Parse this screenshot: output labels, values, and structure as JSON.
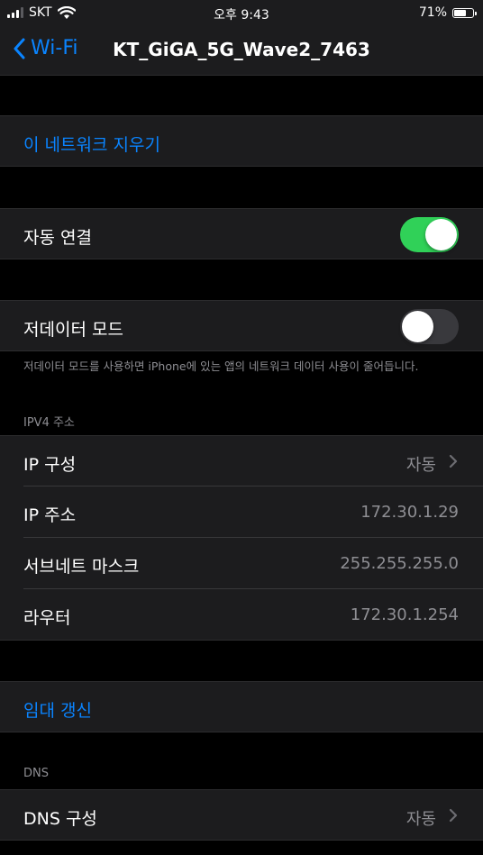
{
  "status_bar": {
    "carrier": "SKT",
    "time": "오후 9:43",
    "battery_percent": "71%",
    "battery_level": 0.71
  },
  "nav": {
    "back_label": "Wi-Fi",
    "title": "KT_GiGA_5G_Wave2_7463"
  },
  "forget_network": {
    "label": "이 네트워크 지우기"
  },
  "auto_join": {
    "label": "자동 연결",
    "enabled": true
  },
  "low_data_mode": {
    "label": "저데이터 모드",
    "enabled": false,
    "footer": "저데이터 모드를 사용하면 iPhone에 있는 앱의 네트워크 데이터 사용이 줄어듭니다."
  },
  "ipv4": {
    "header": "IPV4 주소",
    "rows": [
      {
        "label": "IP 구성",
        "value": "자동",
        "chevron": true
      },
      {
        "label": "IP 주소",
        "value": "172.30.1.29",
        "chevron": false
      },
      {
        "label": "서브네트 마스크",
        "value": "255.255.255.0",
        "chevron": false
      },
      {
        "label": "라우터",
        "value": "172.30.1.254",
        "chevron": false
      }
    ]
  },
  "renew_lease": {
    "label": "임대 갱신"
  },
  "dns": {
    "header": "DNS",
    "configure_label": "DNS 구성",
    "configure_value": "자동"
  },
  "colors": {
    "accent": "#0a84ff",
    "toggle_on": "#30d158",
    "toggle_off": "#39393d",
    "cell_background": "#1c1c1e",
    "background": "#000000"
  }
}
